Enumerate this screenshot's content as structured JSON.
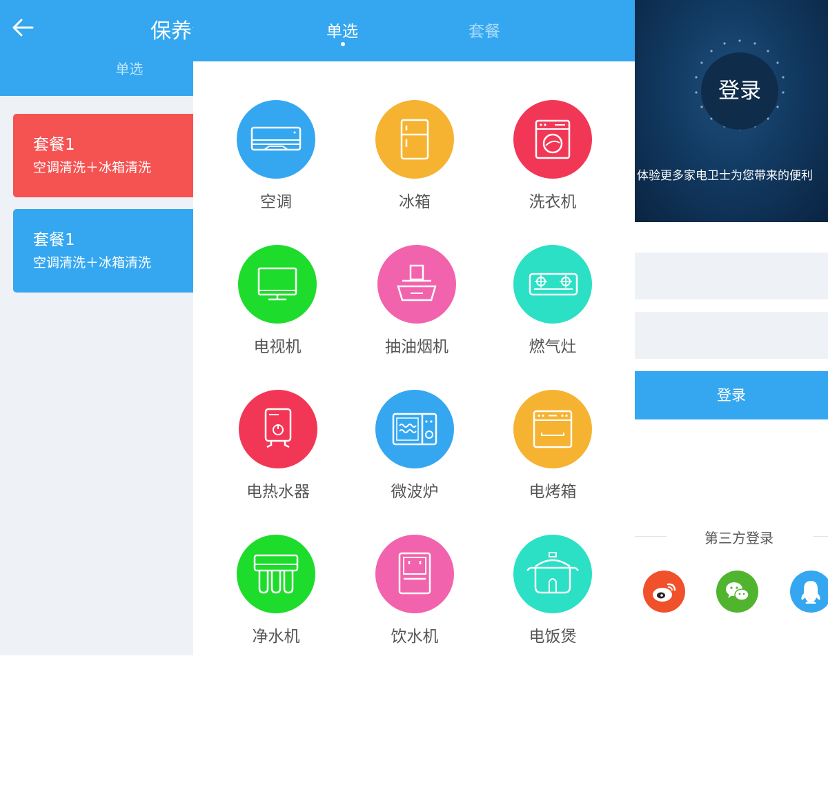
{
  "left_panel": {
    "title": "保养清",
    "subtab": "单选",
    "packages": [
      {
        "title": "套餐1",
        "desc": "空调清洗＋冰箱清洗",
        "color": "#f55252"
      },
      {
        "title": "套餐1",
        "desc": "空调清洗＋冰箱清洗",
        "color": "#34a7f0"
      }
    ]
  },
  "middle_panel": {
    "tabs": [
      {
        "label": "单选",
        "active": true
      },
      {
        "label": "套餐",
        "active": false
      }
    ],
    "appliances": [
      {
        "label": "空调",
        "icon": "air-conditioner-icon",
        "color": "#34a7f0"
      },
      {
        "label": "冰箱",
        "icon": "refrigerator-icon",
        "color": "#f5b331"
      },
      {
        "label": "洗衣机",
        "icon": "washing-machine-icon",
        "color": "#f23756"
      },
      {
        "label": "电视机",
        "icon": "tv-icon",
        "color": "#1edc2c"
      },
      {
        "label": "抽油烟机",
        "icon": "range-hood-icon",
        "color": "#f263ad"
      },
      {
        "label": "燃气灶",
        "icon": "gas-stove-icon",
        "color": "#2be0c4"
      },
      {
        "label": "电热水器",
        "icon": "water-heater-icon",
        "color": "#f23756"
      },
      {
        "label": "微波炉",
        "icon": "microwave-icon",
        "color": "#34a7f0"
      },
      {
        "label": "电烤箱",
        "icon": "oven-icon",
        "color": "#f5b331"
      },
      {
        "label": "净水机",
        "icon": "water-purifier-icon",
        "color": "#1edc2c"
      },
      {
        "label": "饮水机",
        "icon": "water-dispenser-icon",
        "color": "#f263ad"
      },
      {
        "label": "电饭煲",
        "icon": "rice-cooker-icon",
        "color": "#2be0c4"
      }
    ]
  },
  "right_panel": {
    "login_circle": "登录",
    "slogan": "体验更多家电卫士为您带来的便利",
    "username_placeholder": "",
    "password_placeholder": "",
    "login_button": "登录",
    "third_party_label": "第三方登录",
    "social": [
      {
        "icon": "weibo-icon",
        "color": "#f0502a"
      },
      {
        "icon": "wechat-icon",
        "color": "#51b42f"
      },
      {
        "icon": "qq-icon",
        "color": "#34a7f0"
      }
    ]
  },
  "colors": {
    "primary_blue": "#34a7f0",
    "background_gray": "#eef1f5",
    "red": "#f55252"
  }
}
